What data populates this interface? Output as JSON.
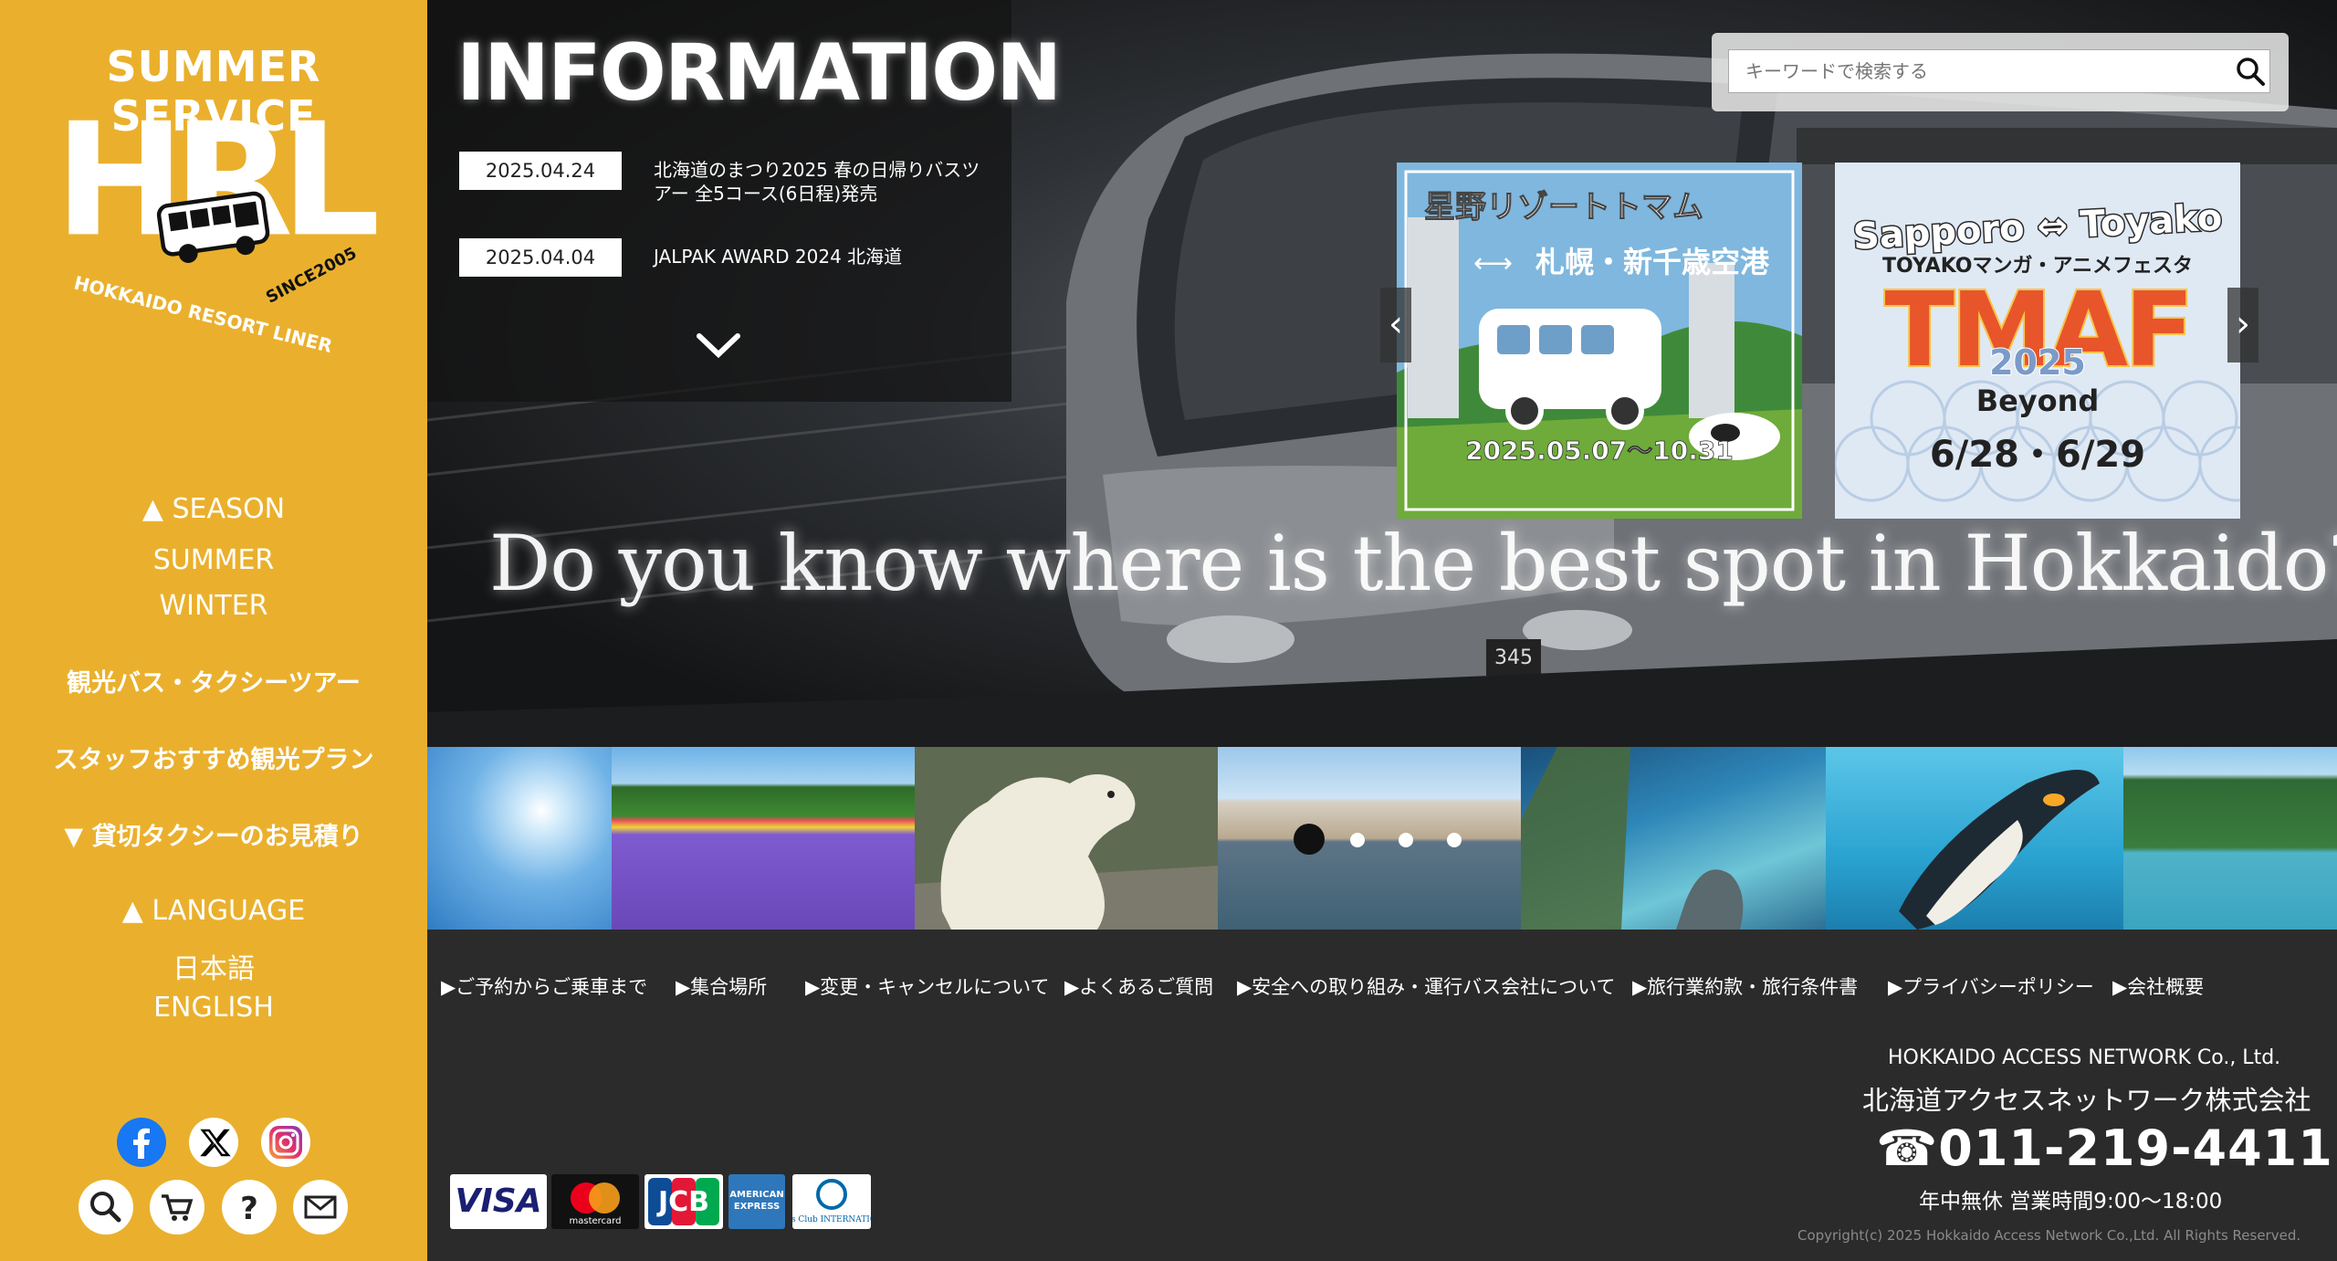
{
  "sidebar": {
    "tagline": "SUMMER SERVICE",
    "logo_text": "HRL",
    "logo_sub": "HOKKAIDO RESORT LINER",
    "logo_since": "SINCE2005",
    "season_label": "SEASON",
    "season_items": [
      "SUMMER",
      "WINTER"
    ],
    "tour_link": "観光バス・タクシーツアー",
    "plan_link": "スタッフおすすめ観光プラン",
    "taxi_link": "貸切タクシーのお見積り",
    "language_label": "LANGUAGE",
    "language_items": [
      "日本語",
      "ENGLISH"
    ]
  },
  "hero": {
    "info_title": "INFORMATION",
    "news": [
      {
        "date": "2025.04.24",
        "text": "北海道のまつり2025 春の日帰りバスツアー 全5コース(6日程)発売"
      },
      {
        "date": "2025.04.04",
        "text": "JALPAK AWARD 2024 北海道"
      }
    ],
    "tagline": "Do you know where is the best spot in Hokkaido?",
    "bus_number": "345",
    "search_placeholder": "キーワードで検索する"
  },
  "banners": [
    {
      "title": "星野リゾートトマム",
      "route": "札幌・新千歳空港",
      "dates": "2025.05.07〜10.31"
    },
    {
      "title": "Sapporo ⇔ Toyako",
      "subtitle": "TOYAKOマンガ・アニメフェスタ",
      "logo": "TMAF",
      "year": "2025",
      "theme": "Beyond",
      "dates": "6/28・6/29"
    }
  ],
  "footer": {
    "links": [
      "▶ご予約からご乗車まで",
      "▶集合場所",
      "▶変更・キャンセルについて",
      "▶よくあるご質問",
      "▶安全への取り組み・運行バス会社について",
      "▶旅行業約款・旅行条件書",
      "▶プライバシーポリシー",
      "▶会社概要"
    ],
    "company_en": "HOKKAIDO ACCESS NETWORK Co., Ltd.",
    "company_ja": "北海道アクセスネットワーク株式会社",
    "phone": "011-219-4411",
    "hours": "年中無休 営業時間9:00〜18:00",
    "copyright": "Copyright(c) 2025 Hokkaido Access Network Co.,Ltd. All Rights Reserved.",
    "cards": [
      "VISA",
      "mastercard",
      "JCB",
      "AMERICAN EXPRESS",
      "Diners Club INTERNATIONAL"
    ]
  },
  "colors": {
    "sidebar_bg": "#eab02d",
    "footer_bg": "#2b2b2b"
  },
  "icons": {
    "social": [
      "facebook-icon",
      "x-icon",
      "instagram-icon"
    ],
    "utility": [
      "search-icon",
      "cart-icon",
      "help-icon",
      "mail-icon"
    ]
  }
}
